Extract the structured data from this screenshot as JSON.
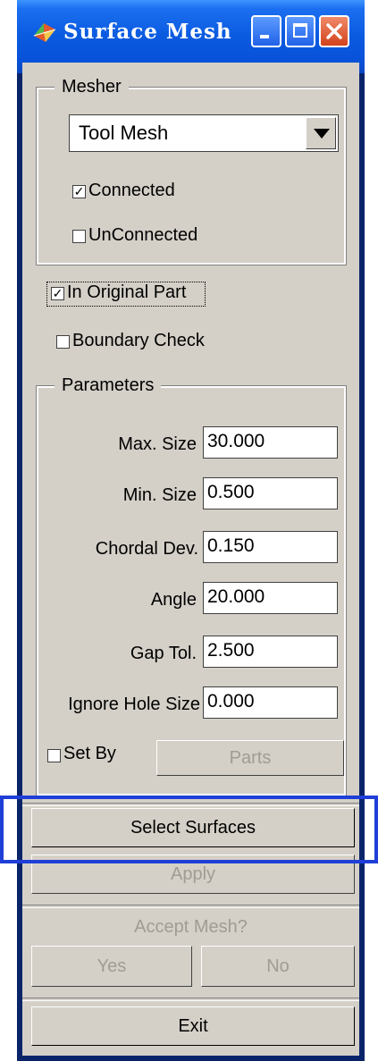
{
  "window": {
    "title": "Surface Mesh"
  },
  "mesher": {
    "legend": "Mesher",
    "selected": "Tool Mesh",
    "connected_label": "Connected",
    "connected_checked": true,
    "unconnected_label": "UnConnected",
    "unconnected_checked": false
  },
  "options": {
    "in_original_part_label": "In Original Part",
    "in_original_part_checked": true,
    "boundary_check_label": "Boundary Check",
    "boundary_check_checked": false
  },
  "parameters": {
    "legend": "Parameters",
    "fields": [
      {
        "label": "Max. Size",
        "value": "30.000"
      },
      {
        "label": "Min. Size",
        "value": "0.500"
      },
      {
        "label": "Chordal Dev.",
        "value": "0.150"
      },
      {
        "label": "Angle",
        "value": "20.000"
      },
      {
        "label": "Gap Tol.",
        "value": "2.500"
      },
      {
        "label": "Ignore Hole Size",
        "value": "0.000"
      }
    ],
    "set_by_label": "Set By",
    "set_by_checked": false,
    "parts_button": "Parts"
  },
  "actions": {
    "select_surfaces": "Select Surfaces",
    "apply": "Apply",
    "accept_mesh": "Accept Mesh?",
    "yes": "Yes",
    "no": "No",
    "exit": "Exit"
  },
  "colors": {
    "highlight": "#1f3fd8",
    "titlebar": "#0a5ae0",
    "panel": "#d4d0c8"
  },
  "icons": {
    "app": "mesh-app-icon",
    "minimize": "minimize-icon",
    "maximize": "maximize-icon",
    "close": "close-icon"
  }
}
